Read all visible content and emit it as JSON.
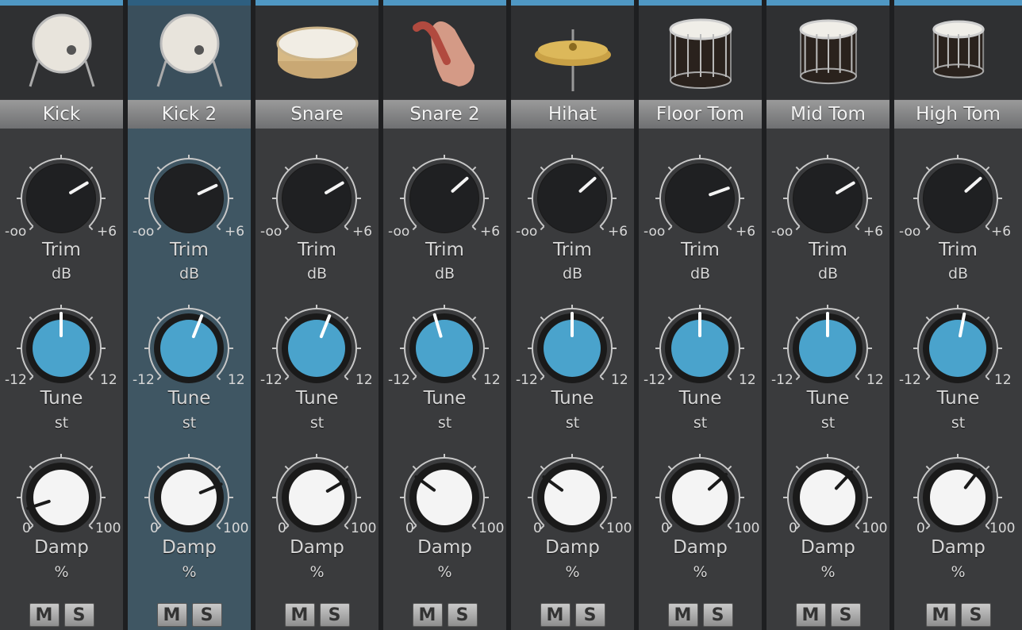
{
  "controls": {
    "trim": {
      "label": "Trim",
      "unit": "dB",
      "min_label": "-oo",
      "max_label": "+6"
    },
    "tune": {
      "label": "Tune",
      "unit": "st",
      "min_label": "-12",
      "max_label": "12"
    },
    "damp": {
      "label": "Damp",
      "unit": "%",
      "min_label": "0",
      "max_label": "100"
    }
  },
  "buttons": {
    "mute_label": "M",
    "solo_label": "S"
  },
  "colors": {
    "accent": "#4f97c3",
    "tune_knob": "#4aa3cc",
    "damp_knob": "#f4f4f4",
    "trim_knob": "#1c1c1c",
    "selected_channel": "#3f5663"
  },
  "channels": [
    {
      "name": "Kick",
      "icon": "kick-drum-icon",
      "selected": false,
      "trim": 0.72,
      "tune": 0.5,
      "damp": 0.1
    },
    {
      "name": "Kick 2",
      "icon": "kick-drum-icon",
      "selected": true,
      "trim": 0.74,
      "tune": 0.58,
      "damp": 0.75
    },
    {
      "name": "Snare",
      "icon": "snare-drum-icon",
      "selected": false,
      "trim": 0.72,
      "tune": 0.58,
      "damp": 0.72
    },
    {
      "name": "Snare 2",
      "icon": "hand-clap-icon",
      "selected": false,
      "trim": 0.68,
      "tune": 0.44,
      "damp": 0.3
    },
    {
      "name": "Hihat",
      "icon": "hihat-cymbal-icon",
      "selected": false,
      "trim": 0.68,
      "tune": 0.5,
      "damp": 0.3
    },
    {
      "name": "Floor Tom",
      "icon": "floor-tom-icon",
      "selected": false,
      "trim": 0.76,
      "tune": 0.5,
      "damp": 0.68
    },
    {
      "name": "Mid Tom",
      "icon": "mid-tom-icon",
      "selected": false,
      "trim": 0.72,
      "tune": 0.5,
      "damp": 0.66
    },
    {
      "name": "High Tom",
      "icon": "high-tom-icon",
      "selected": false,
      "trim": 0.68,
      "tune": 0.54,
      "damp": 0.64
    }
  ]
}
